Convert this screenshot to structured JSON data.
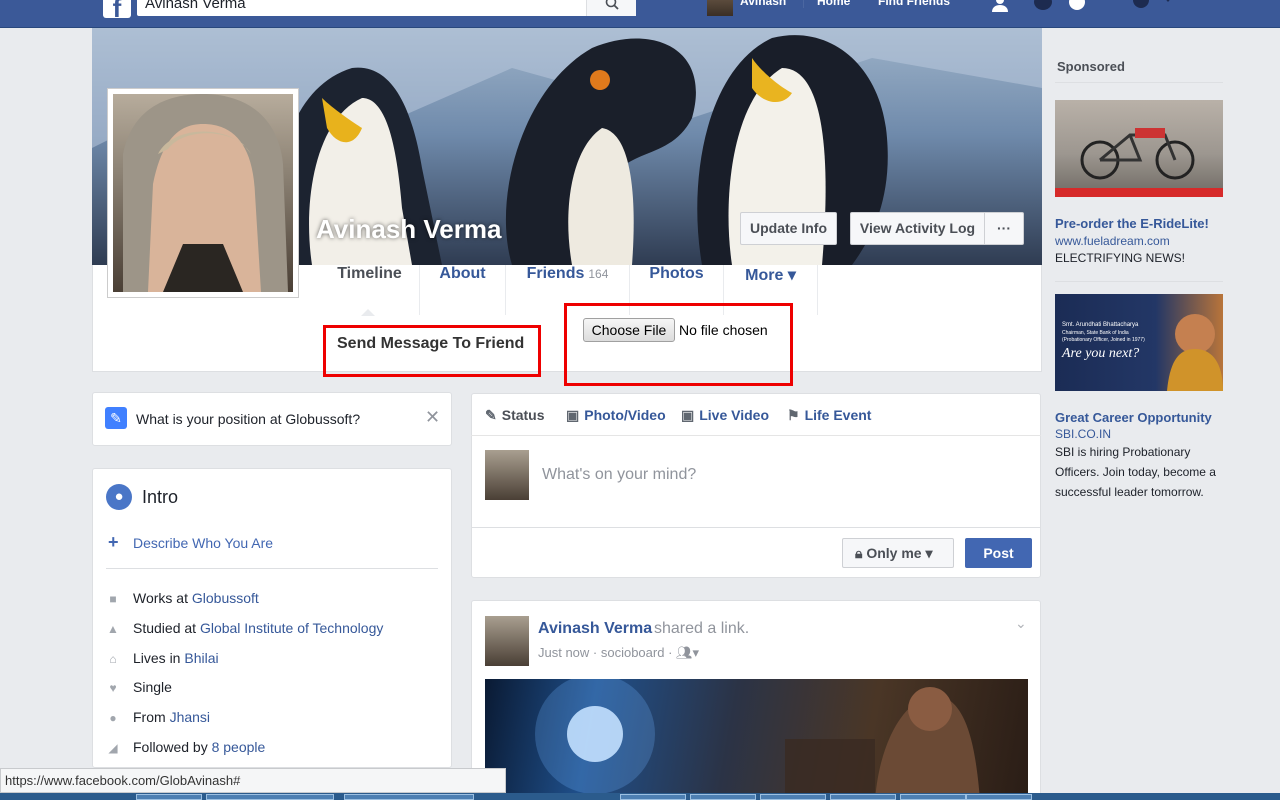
{
  "topbar": {
    "search_value": "Avinash Verma",
    "user_name": "Avinash",
    "home": "Home",
    "find_friends": "Find Friends"
  },
  "profile": {
    "name": "Avinash Verma",
    "update_info": "Update Info",
    "view_activity_log": "View Activity Log",
    "more_dots": "···"
  },
  "tabs": {
    "timeline": "Timeline",
    "about": "About",
    "friends": "Friends",
    "friends_count": "164",
    "photos": "Photos",
    "more": "More ▾"
  },
  "injected": {
    "send_message": "Send Message To Friend",
    "choose_file": "Choose File",
    "no_file": "No file chosen"
  },
  "position_prompt": "What is your position at Globussoft?",
  "intro": {
    "title": "Intro",
    "describe": "Describe Who You Are",
    "rows": [
      {
        "prefix": "Works at ",
        "link": "Globussoft",
        "icon": "briefcase-icon"
      },
      {
        "prefix": "Studied at ",
        "link": "Global Institute of Technology",
        "icon": "school-icon"
      },
      {
        "prefix": "Lives in ",
        "link": "Bhilai",
        "icon": "home-icon"
      },
      {
        "prefix": "Single",
        "link": "",
        "icon": "heart-icon"
      },
      {
        "prefix": "From ",
        "link": "Jhansi",
        "icon": "location-pin-icon"
      },
      {
        "prefix": "Followed by ",
        "link": "8 people",
        "icon": "rss-icon"
      }
    ]
  },
  "composer": {
    "status": "Status",
    "photo_video": "Photo/Video",
    "live_video": "Live Video",
    "life_event": "Life Event",
    "placeholder": "What's on your mind?",
    "privacy": "Only me",
    "post": "Post"
  },
  "feed_post": {
    "author": "Avinash Verma",
    "action": "shared a link.",
    "meta": "Just now · socioboard ·"
  },
  "sponsored": {
    "header": "Sponsored",
    "ads": [
      {
        "title": "Pre-order the E-RideLite!",
        "domain": "www.fueladream.com",
        "text": "ELECTRIFYING NEWS!"
      },
      {
        "title": "Great Career Opportunity",
        "domain": "SBI.CO.IN",
        "text": "SBI is hiring Probationary Officers. Join today, become a successful leader tomorrow."
      }
    ]
  },
  "ad2_image_text": {
    "name": "Smt. Arundhati Bhattacharya",
    "role": "Chairman, State Bank of India",
    "note": "(Probationary Officer, Joined in 1977)",
    "tagline": "Are you next?"
  },
  "status_url": "https://www.facebook.com/GlobAvinash#",
  "colors": {
    "brand": "#3b5998",
    "link": "#365899",
    "highlight_box": "#ee0000",
    "post_button": "#4267b2"
  }
}
